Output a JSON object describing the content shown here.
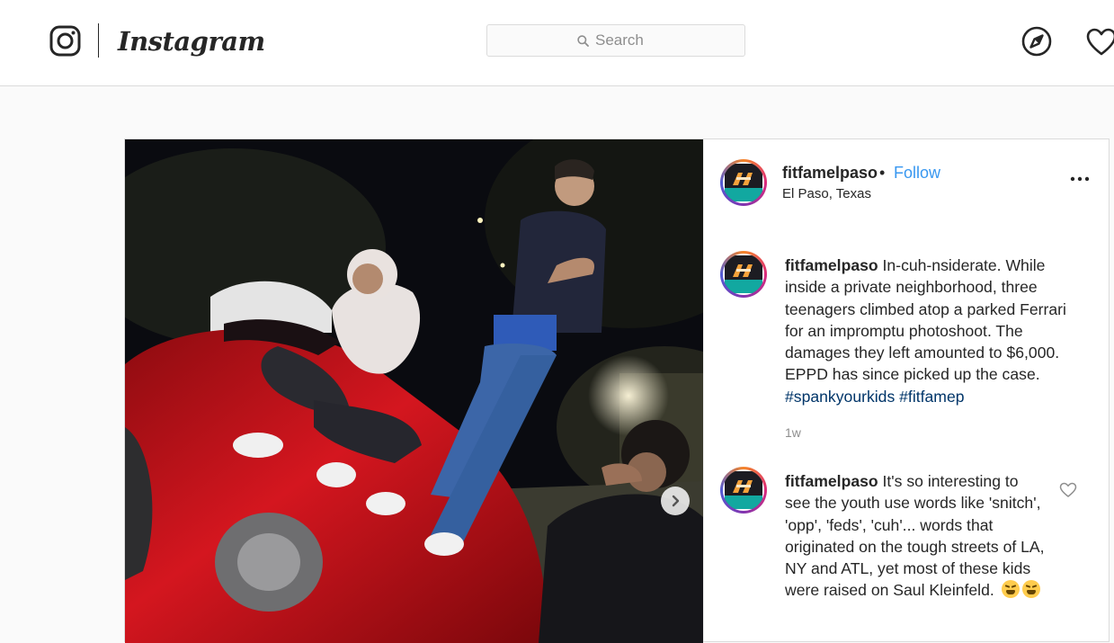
{
  "header": {
    "camera_icon": "instagram-camera-icon",
    "brand": "Instagram",
    "search": {
      "placeholder": "Search",
      "value": ""
    },
    "icons": [
      "explore-compass-icon",
      "activity-heart-icon"
    ]
  },
  "post": {
    "username": "fitfamelpaso",
    "separator": "•",
    "follow_label": "Follow",
    "location": "El Paso, Texas",
    "more_icon": "more-options-icon",
    "next_icon": "chevron-right-icon",
    "caption": {
      "username": "fitfamelpaso",
      "text": "In-cuh-nsiderate. While inside a private neighborhood, three teenagers climbed atop a parked Ferrari for an impromptu photoshoot. The damages they left amounted to $6,000. EPPD has since picked up the case.",
      "hashtags": [
        "#spankyourkids",
        "#fitfamep"
      ],
      "time": "1w"
    },
    "comments": [
      {
        "username": "fitfamelpaso",
        "text": "It's so interesting to see the youth use words like 'snitch', 'opp', 'feds', 'cuh'... words that originated on the tough streets of LA, NY and ATL, yet most of these kids were raised on Saul Kleinfeld.",
        "emojis": [
          "tired-face-emoji",
          "tired-face-emoji"
        ],
        "like_icon": "like-heart-icon"
      }
    ]
  },
  "colors": {
    "link_blue": "#3897f0",
    "hashtag": "#003569",
    "border": "#dbdbdb",
    "muted": "#8e8e8e",
    "car_red": "#c8121a"
  }
}
